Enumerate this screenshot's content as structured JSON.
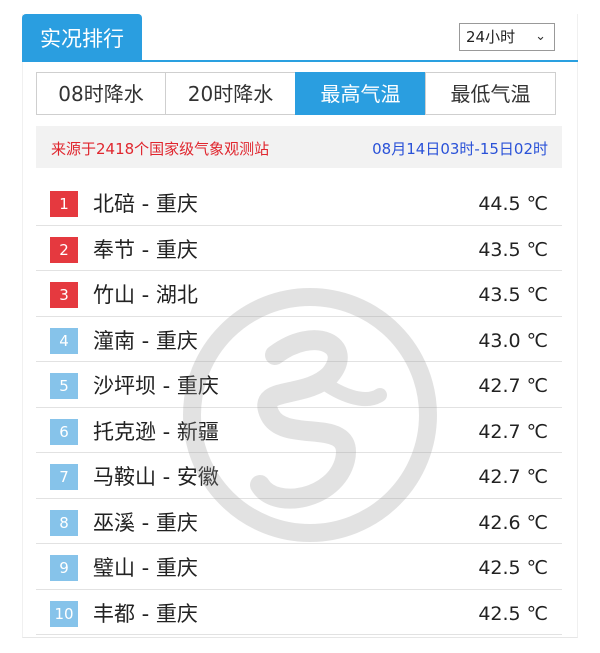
{
  "header": {
    "title": "实况排行",
    "period_select": {
      "value": "24小时"
    }
  },
  "tabs": [
    {
      "label": "08时降水",
      "active": false
    },
    {
      "label": "20时降水",
      "active": false
    },
    {
      "label": "最高气温",
      "active": true
    },
    {
      "label": "最低气温",
      "active": false
    }
  ],
  "info": {
    "source": "来源于2418个国家级气象观测站",
    "time_range": "08月14日03时-15日02时"
  },
  "rankings": [
    {
      "rank": "1",
      "station": "北碚 - 重庆",
      "temp": "44.5 ℃",
      "color": "red"
    },
    {
      "rank": "2",
      "station": "奉节 - 重庆",
      "temp": "43.5 ℃",
      "color": "red"
    },
    {
      "rank": "3",
      "station": "竹山 - 湖北",
      "temp": "43.5 ℃",
      "color": "red"
    },
    {
      "rank": "4",
      "station": "潼南 - 重庆",
      "temp": "43.0 ℃",
      "color": "blue"
    },
    {
      "rank": "5",
      "station": "沙坪坝 - 重庆",
      "temp": "42.7 ℃",
      "color": "blue"
    },
    {
      "rank": "6",
      "station": "托克逊 - 新疆",
      "temp": "42.7 ℃",
      "color": "blue"
    },
    {
      "rank": "7",
      "station": "马鞍山 - 安徽",
      "temp": "42.7 ℃",
      "color": "blue"
    },
    {
      "rank": "8",
      "station": "巫溪 - 重庆",
      "temp": "42.6 ℃",
      "color": "blue"
    },
    {
      "rank": "9",
      "station": "璧山 - 重庆",
      "temp": "42.5 ℃",
      "color": "blue"
    },
    {
      "rank": "10",
      "station": "丰都 - 重庆",
      "temp": "42.5 ℃",
      "color": "blue"
    }
  ],
  "colors": {
    "accent": "#2a9ee0",
    "rank_top": "#e5393f",
    "rank_other": "#86c3ea",
    "source_text": "#e0262e",
    "time_text": "#2a52d8"
  }
}
